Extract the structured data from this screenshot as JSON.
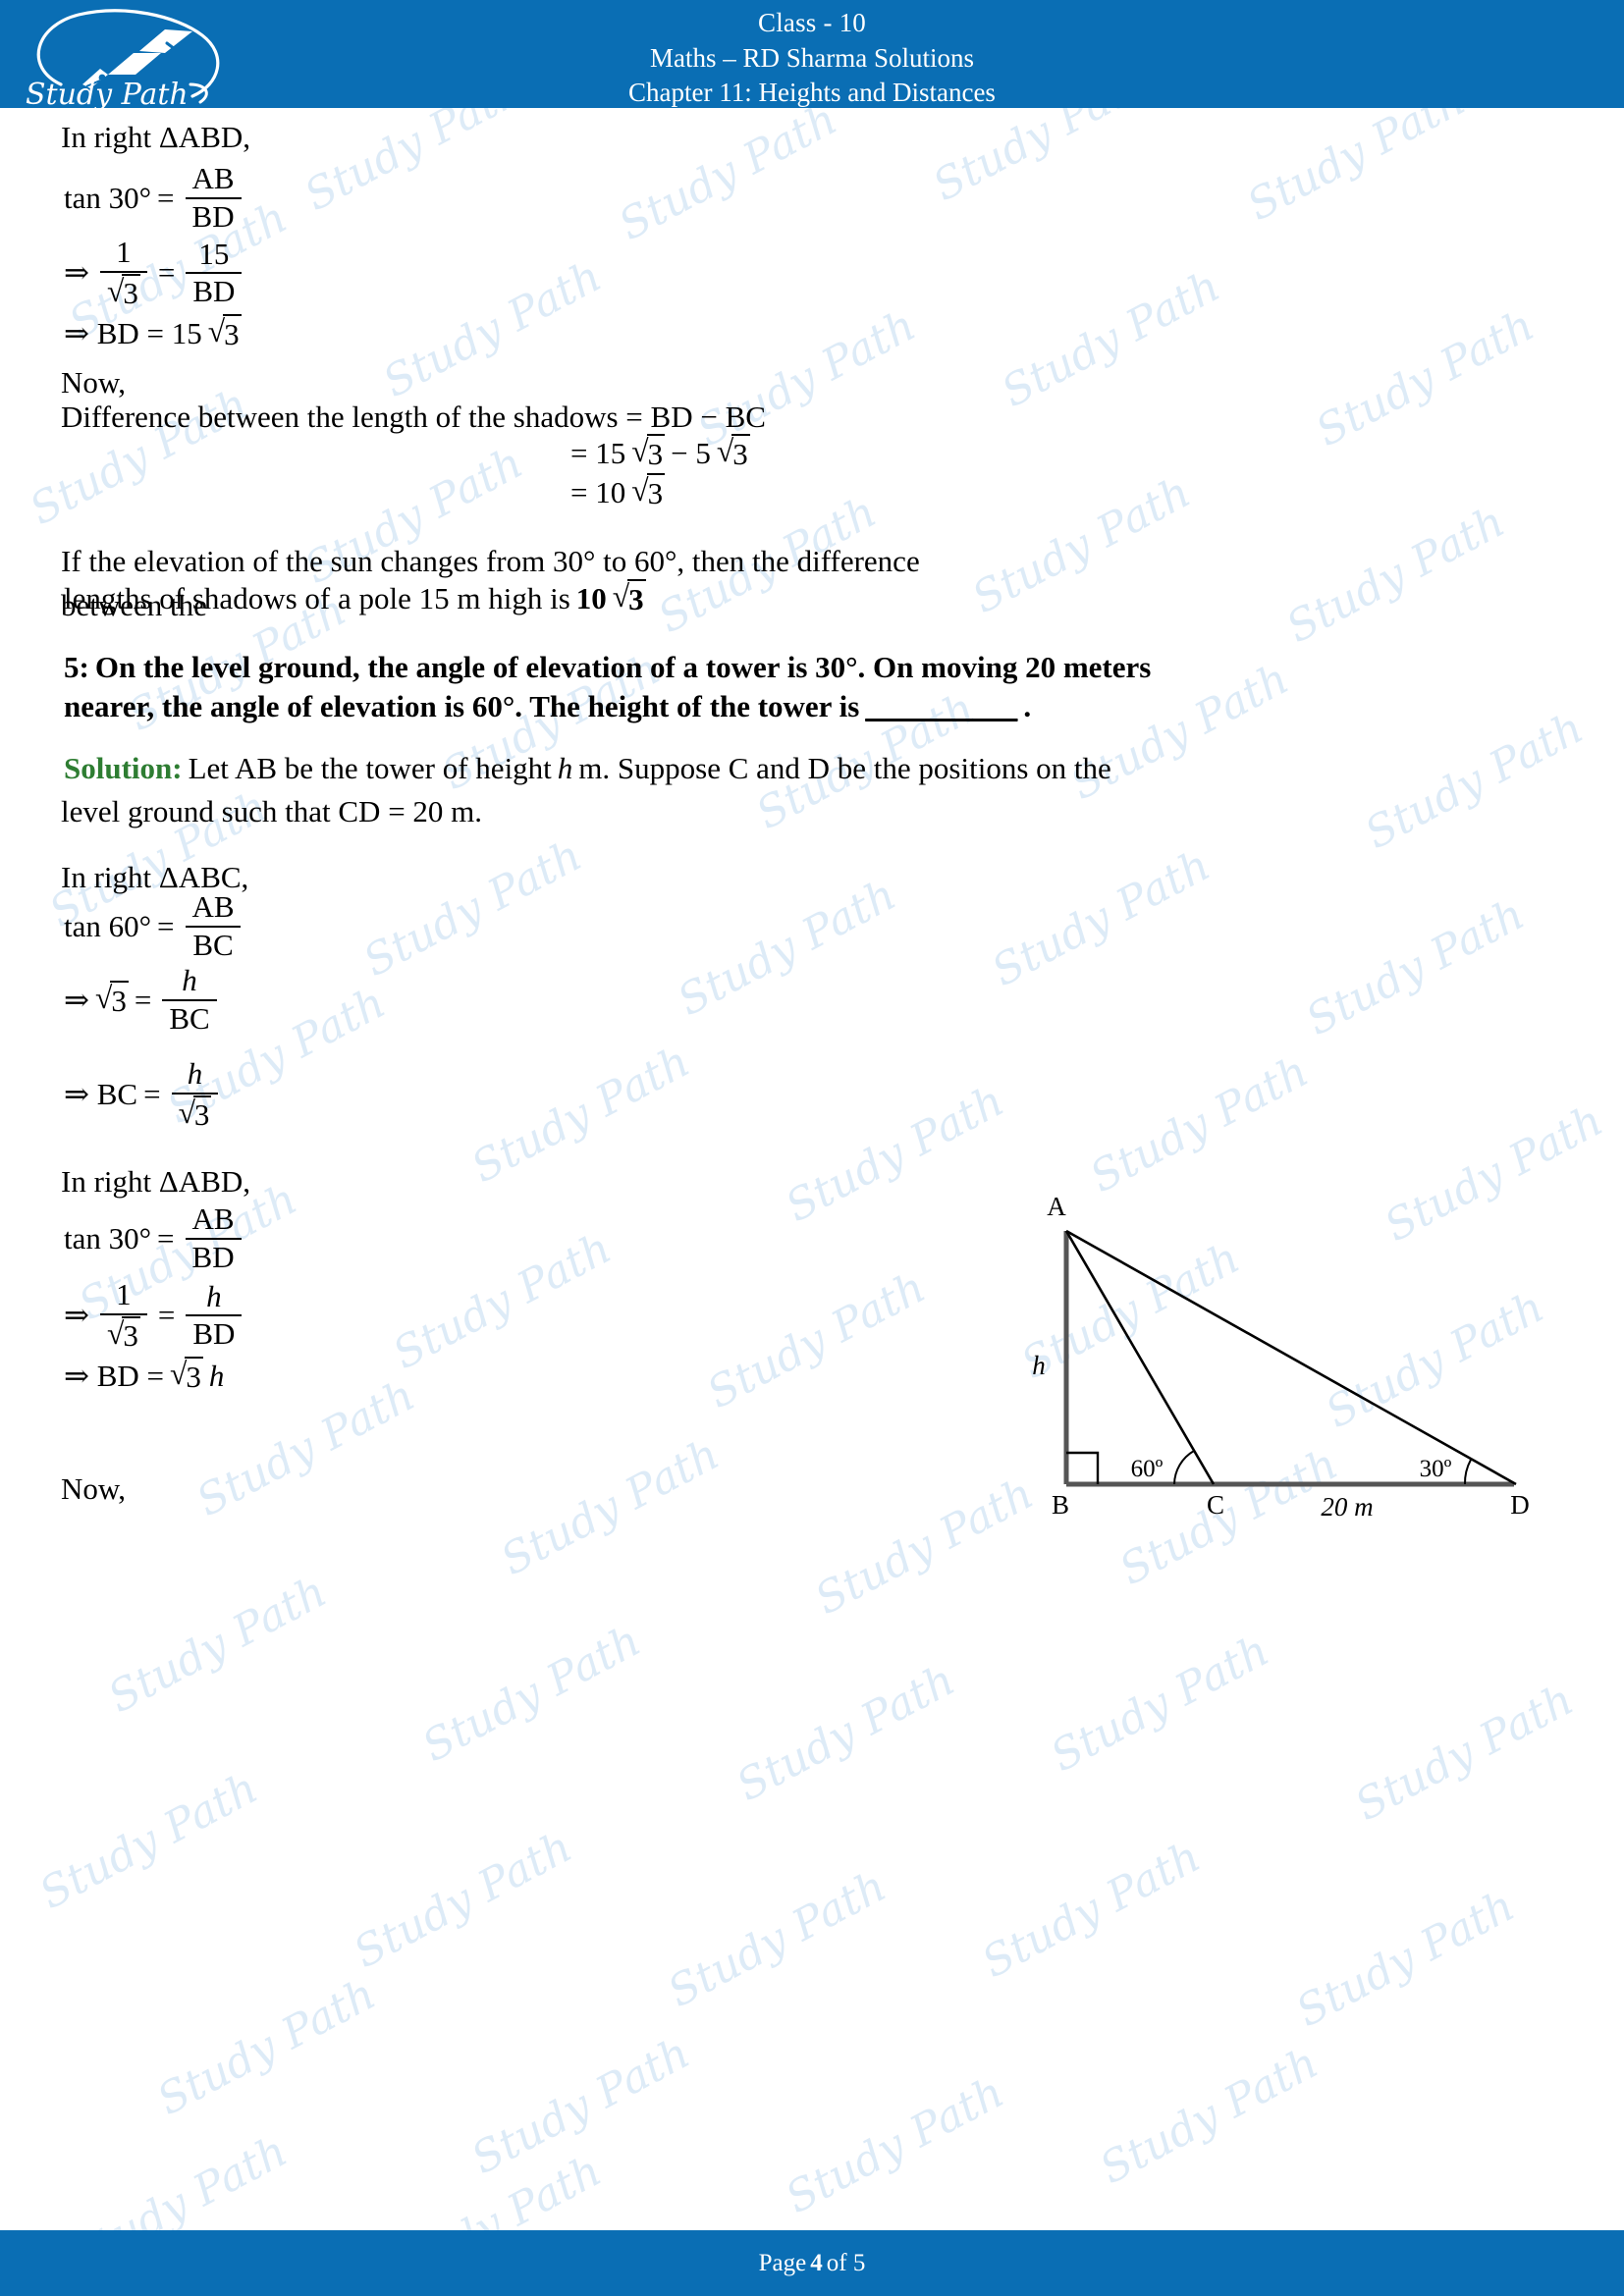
{
  "header": {
    "logo_name": "study-path-logo",
    "logo_text": "Study Path",
    "line1": "Class - 10",
    "line2": "Maths – RD Sharma Solutions",
    "line3": "Chapter 11: Heights and Distances",
    "bg_color": "#0A6EB4"
  },
  "footer": {
    "prefix": "Page",
    "page_number": "4",
    "suffix": "of 5"
  },
  "watermark": {
    "text": "Study Path",
    "color": "#dceaf7"
  },
  "body": {
    "q4_continued": {
      "line_in_right_abd": "In right ΔABD,",
      "eq_tan30_label": "tan 30°",
      "eq_equals": "=",
      "eq_ab": "AB",
      "eq_bd": "BD",
      "implies": "⇒",
      "one": "1",
      "root3": "3",
      "fifteen": "15",
      "bd_result_prefix": "⇒ BD  =  15",
      "bd_result_root": "3",
      "now": "Now,",
      "difference_text": "Difference between the length of the shadows  =  BD − BC",
      "diff_step1_prefix": "=  15",
      "diff_step1_mid": "− 5",
      "diff_step2_prefix": "=  10",
      "answer_sentence_part1": "If the elevation of the sun changes from 30° to 60°, then the difference between the",
      "answer_sentence_part2": "lengths of shadows of a pole 15 m high is ",
      "answer_value_coeff": "10",
      "answer_value_radicand": "3"
    },
    "question5": {
      "number": "5:",
      "line1": "On the level ground, the angle of elevation of a tower is 30°. On moving 20 meters",
      "line2_a": "nearer, the angle of elevation is 60°. The height of the tower is ",
      "blank": "__________",
      "line2_b": "."
    },
    "solution": {
      "label": "Solution:",
      "line1_a": "Let AB be the tower of height ",
      "line1_h": "h",
      "line1_b": " m. Suppose C and D be the positions on the",
      "line2": "level ground such that CD = 20 m."
    },
    "abc_block": {
      "heading": "In right ΔABC,",
      "tan_label": "tan 60°",
      "equals": "=",
      "num": "AB",
      "den": "BC",
      "implies": "⇒",
      "root_radicand": "3",
      "h": "h",
      "den2": "BC",
      "bc_label": "⇒ BC",
      "bc_num": "h",
      "bc_den_radicand": "3"
    },
    "abd_block": {
      "heading": "In right ΔABD,",
      "tan_label": "tan 30°",
      "equals": "=",
      "num": "AB",
      "den": "BD",
      "implies": "⇒",
      "one": "1",
      "root3": "3",
      "h": "h",
      "den2": "BD",
      "bd_label": "⇒ BD  =  ",
      "bd_root_radicand": "3",
      "bd_h": "h"
    },
    "trailing_now": "Now,"
  },
  "diagram": {
    "name": "tower-elevation-triangle",
    "vertex_a": "A",
    "vertex_b": "B",
    "vertex_c": "C",
    "vertex_d": "D",
    "height_label": "h",
    "angle_at_c": "60º",
    "angle_at_d": "30º",
    "base_label": "20 m",
    "stroke_color": "#000000"
  }
}
